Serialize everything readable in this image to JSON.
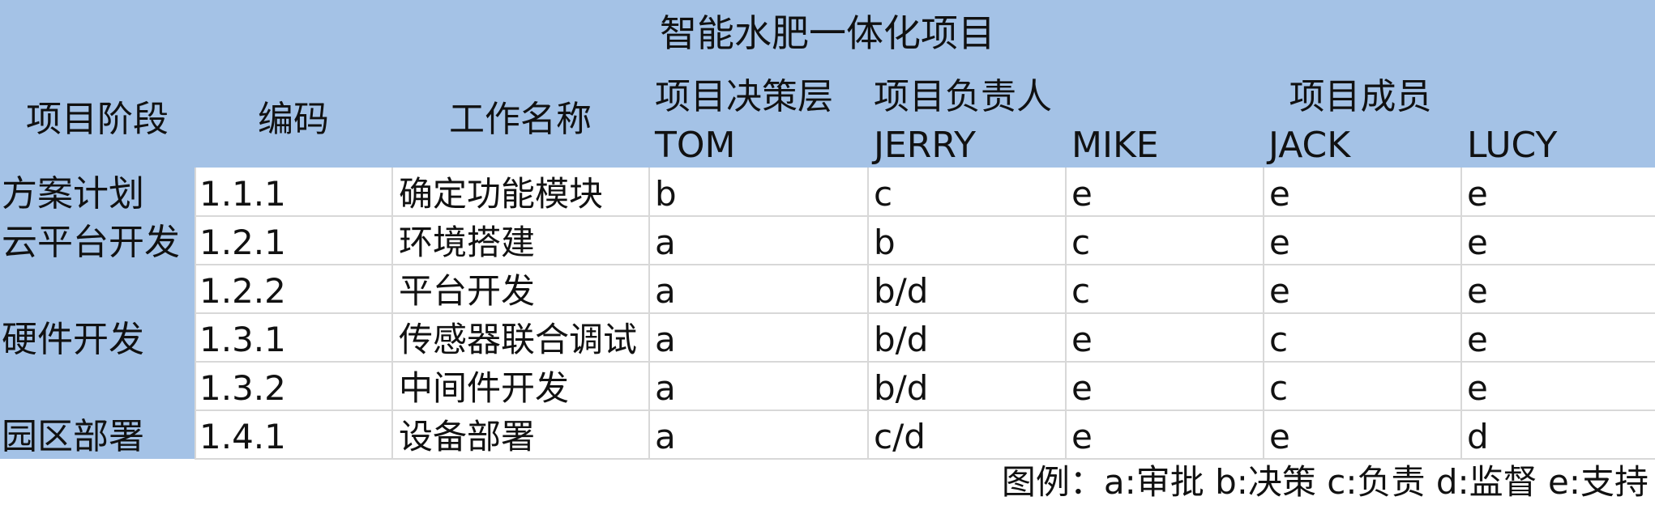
{
  "title": "智能水肥一体化项目",
  "headers": {
    "stage": "项目阶段",
    "code": "编码",
    "task": "工作名称",
    "decision_group": "项目决策层",
    "owner_group": "项目负责人",
    "members_group": "项目成员",
    "people": [
      "TOM",
      "JERRY",
      "MIKE",
      "JACK",
      "LUCY"
    ]
  },
  "stages": [
    "方案计划",
    "云平台开发",
    "硬件开发",
    "园区部署"
  ],
  "rows": [
    {
      "code": "1.1.1",
      "task": "确定功能模块",
      "roles": [
        "b",
        "c",
        "e",
        "e",
        "e"
      ]
    },
    {
      "code": "1.2.1",
      "task": "环境搭建",
      "roles": [
        "a",
        "b",
        "c",
        "e",
        "e"
      ]
    },
    {
      "code": "1.2.2",
      "task": "平台开发",
      "roles": [
        "a",
        "b/d",
        "c",
        "e",
        "e"
      ]
    },
    {
      "code": "1.3.1",
      "task": "传感器联合调试",
      "roles": [
        "a",
        "b/d",
        "e",
        "c",
        "e"
      ]
    },
    {
      "code": "1.3.2",
      "task": "中间件开发",
      "roles": [
        "a",
        "b/d",
        "e",
        "c",
        "e"
      ]
    },
    {
      "code": "1.4.1",
      "task": "设备部署",
      "roles": [
        "a",
        "c/d",
        "e",
        "e",
        "d"
      ]
    }
  ],
  "legend": "图例：a:审批 b:决策 c:负责 d:监督 e:支持",
  "colors": {
    "header_bg": "#a4c2e6",
    "grid": "#d8d8d8"
  }
}
